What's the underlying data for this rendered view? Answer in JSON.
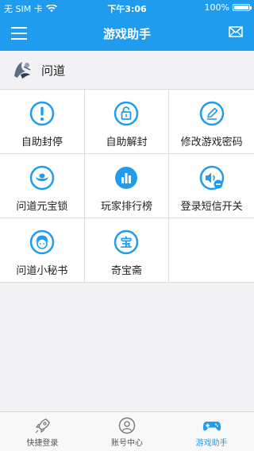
{
  "statusbar": {
    "carrier": "无 SIM 卡",
    "time": "下午3:06",
    "battery": "100%"
  },
  "navbar": {
    "title": "游戏助手"
  },
  "game": {
    "name": "问道"
  },
  "grid": [
    [
      {
        "label": "自助封停",
        "icon": "exclamation-icon"
      },
      {
        "label": "自助解封",
        "icon": "unlock-icon"
      },
      {
        "label": "修改游戏密码",
        "icon": "pencil-icon"
      }
    ],
    [
      {
        "label": "问道元宝锁",
        "icon": "ingot-lock-icon"
      },
      {
        "label": "玩家排行榜",
        "icon": "bar-chart-icon"
      },
      {
        "label": "登录短信开关",
        "icon": "speaker-icon"
      }
    ],
    [
      {
        "label": "问道小秘书",
        "icon": "secretary-icon"
      },
      {
        "label": "奇宝斋",
        "icon": "treasure-icon"
      }
    ]
  ],
  "tabs": [
    {
      "label": "快捷登录",
      "icon": "rocket-icon"
    },
    {
      "label": "账号中心",
      "icon": "user-icon"
    },
    {
      "label": "游戏助手",
      "icon": "gamepad-icon",
      "active": true
    }
  ],
  "colors": {
    "accent": "#1f9cee",
    "background": "#f2f2f5"
  }
}
